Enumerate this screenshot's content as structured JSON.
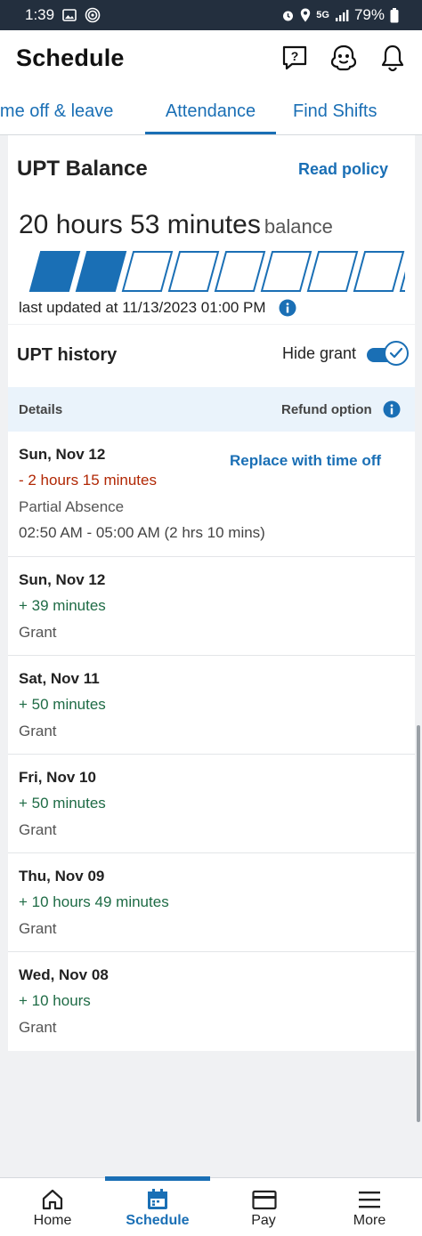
{
  "status_bar": {
    "time": "1:39",
    "battery": "79%",
    "network": "5G"
  },
  "header": {
    "title": "Schedule",
    "icons": [
      "help-chat-icon",
      "assistant-icon",
      "bell-icon"
    ]
  },
  "tabs": [
    {
      "label": "Time off & leave",
      "active": false
    },
    {
      "label": "Attendance",
      "active": true
    },
    {
      "label": "Find Shifts",
      "active": false
    }
  ],
  "balance": {
    "title": "UPT Balance",
    "read_policy": "Read policy",
    "amount": "20 hours 53 minutes",
    "amount_suffix": "balance",
    "bar_fraction": 0.2,
    "last_updated": "last updated at 11/13/2023 01:00 PM"
  },
  "history": {
    "title": "UPT history",
    "toggle_label": "Hide grant",
    "toggle_on": true,
    "col_details": "Details",
    "col_refund": "Refund option",
    "rows": [
      {
        "date": "Sun, Nov 12",
        "amount": "- 2 hours 15 minutes",
        "type": "Partial Absence",
        "range": "02:50 AM - 05:00 AM (2 hrs 10 mins)",
        "action": "Replace with time off"
      },
      {
        "date": "Sun, Nov 12",
        "amount": "+ 39 minutes",
        "type": "Grant"
      },
      {
        "date": "Sat, Nov 11",
        "amount": "+ 50 minutes",
        "type": "Grant"
      },
      {
        "date": "Fri, Nov 10",
        "amount": "+ 50 minutes",
        "type": "Grant"
      },
      {
        "date": "Thu, Nov 09",
        "amount": "+ 10 hours 49 minutes",
        "type": "Grant"
      },
      {
        "date": "Wed, Nov 08",
        "amount": "+ 10 hours",
        "type": "Grant"
      }
    ]
  },
  "bottom_nav": [
    {
      "label": "Home",
      "icon": "home-icon",
      "active": false
    },
    {
      "label": "Schedule",
      "icon": "calendar-icon",
      "active": true
    },
    {
      "label": "Pay",
      "icon": "wallet-icon",
      "active": false
    },
    {
      "label": "More",
      "icon": "menu-icon",
      "active": false
    }
  ],
  "colors": {
    "accent": "#1a6fb5",
    "negative": "#b12704",
    "positive": "#1e6b45",
    "status_bar": "#232f3e"
  }
}
